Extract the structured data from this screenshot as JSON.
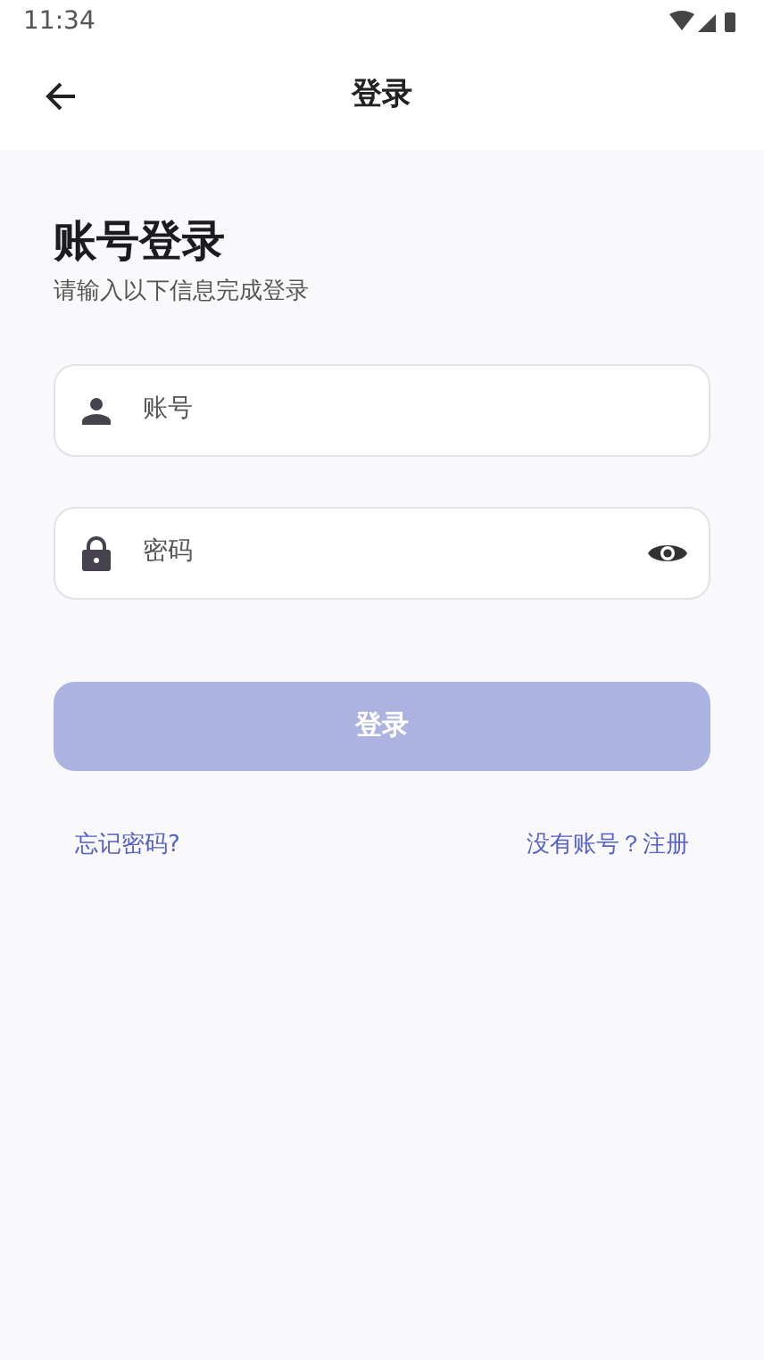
{
  "status_bar": {
    "time": "11:34"
  },
  "app_bar": {
    "title": "登录"
  },
  "heading": "账号登录",
  "subtitle": "请输入以下信息完成登录",
  "fields": [
    {
      "kind": "account",
      "placeholder": "账号"
    },
    {
      "kind": "password",
      "placeholder": "密码"
    }
  ],
  "login_button": {
    "label": "登录",
    "disabled": true
  },
  "links": [
    {
      "label": "忘记密码?"
    },
    {
      "label": "没有账号？注册"
    }
  ]
}
